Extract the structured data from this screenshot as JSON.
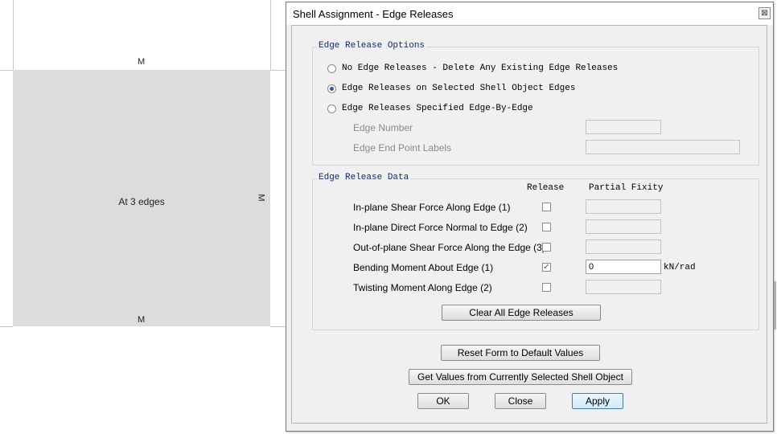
{
  "canvas": {
    "label_top": "M",
    "label_bottom": "M",
    "label_right": "M",
    "center_text": "At 3 edges"
  },
  "dialog": {
    "title": "Shell Assignment - Edge Releases",
    "close_glyph": "⊠",
    "options_group": {
      "title": "Edge Release Options",
      "radios": [
        {
          "label": "No Edge Releases - Delete Any Existing Edge Releases",
          "selected": false
        },
        {
          "label": "Edge Releases on Selected Shell Object Edges",
          "selected": true
        },
        {
          "label": "Edge Releases Specified Edge-By-Edge",
          "selected": false
        }
      ],
      "edge_number_label": "Edge Number",
      "edge_end_point_label": "Edge End Point Labels"
    },
    "data_group": {
      "title": "Edge Release Data",
      "col_release": "Release",
      "col_partial_fixity": "Partial Fixity",
      "rows": [
        {
          "label": "In-plane Shear Force Along Edge (1)",
          "checked": false,
          "value": "",
          "unit": ""
        },
        {
          "label": "In-plane Direct Force Normal to  Edge (2)",
          "checked": false,
          "value": "",
          "unit": ""
        },
        {
          "label": "Out-of-plane Shear Force Along the Edge (3)",
          "checked": false,
          "value": "",
          "unit": ""
        },
        {
          "label": "Bending Moment About Edge (1)",
          "checked": true,
          "value": "0",
          "unit": "kN/rad"
        },
        {
          "label": "Twisting Moment Along Edge (2)",
          "checked": false,
          "value": "",
          "unit": ""
        }
      ],
      "clear_button": "Clear All Edge Releases"
    },
    "buttons": {
      "reset": "Reset Form to Default Values",
      "get_values": "Get Values from Currently Selected Shell Object",
      "ok": "OK",
      "close": "Close",
      "apply": "Apply"
    },
    "check_glyph": "✓"
  }
}
